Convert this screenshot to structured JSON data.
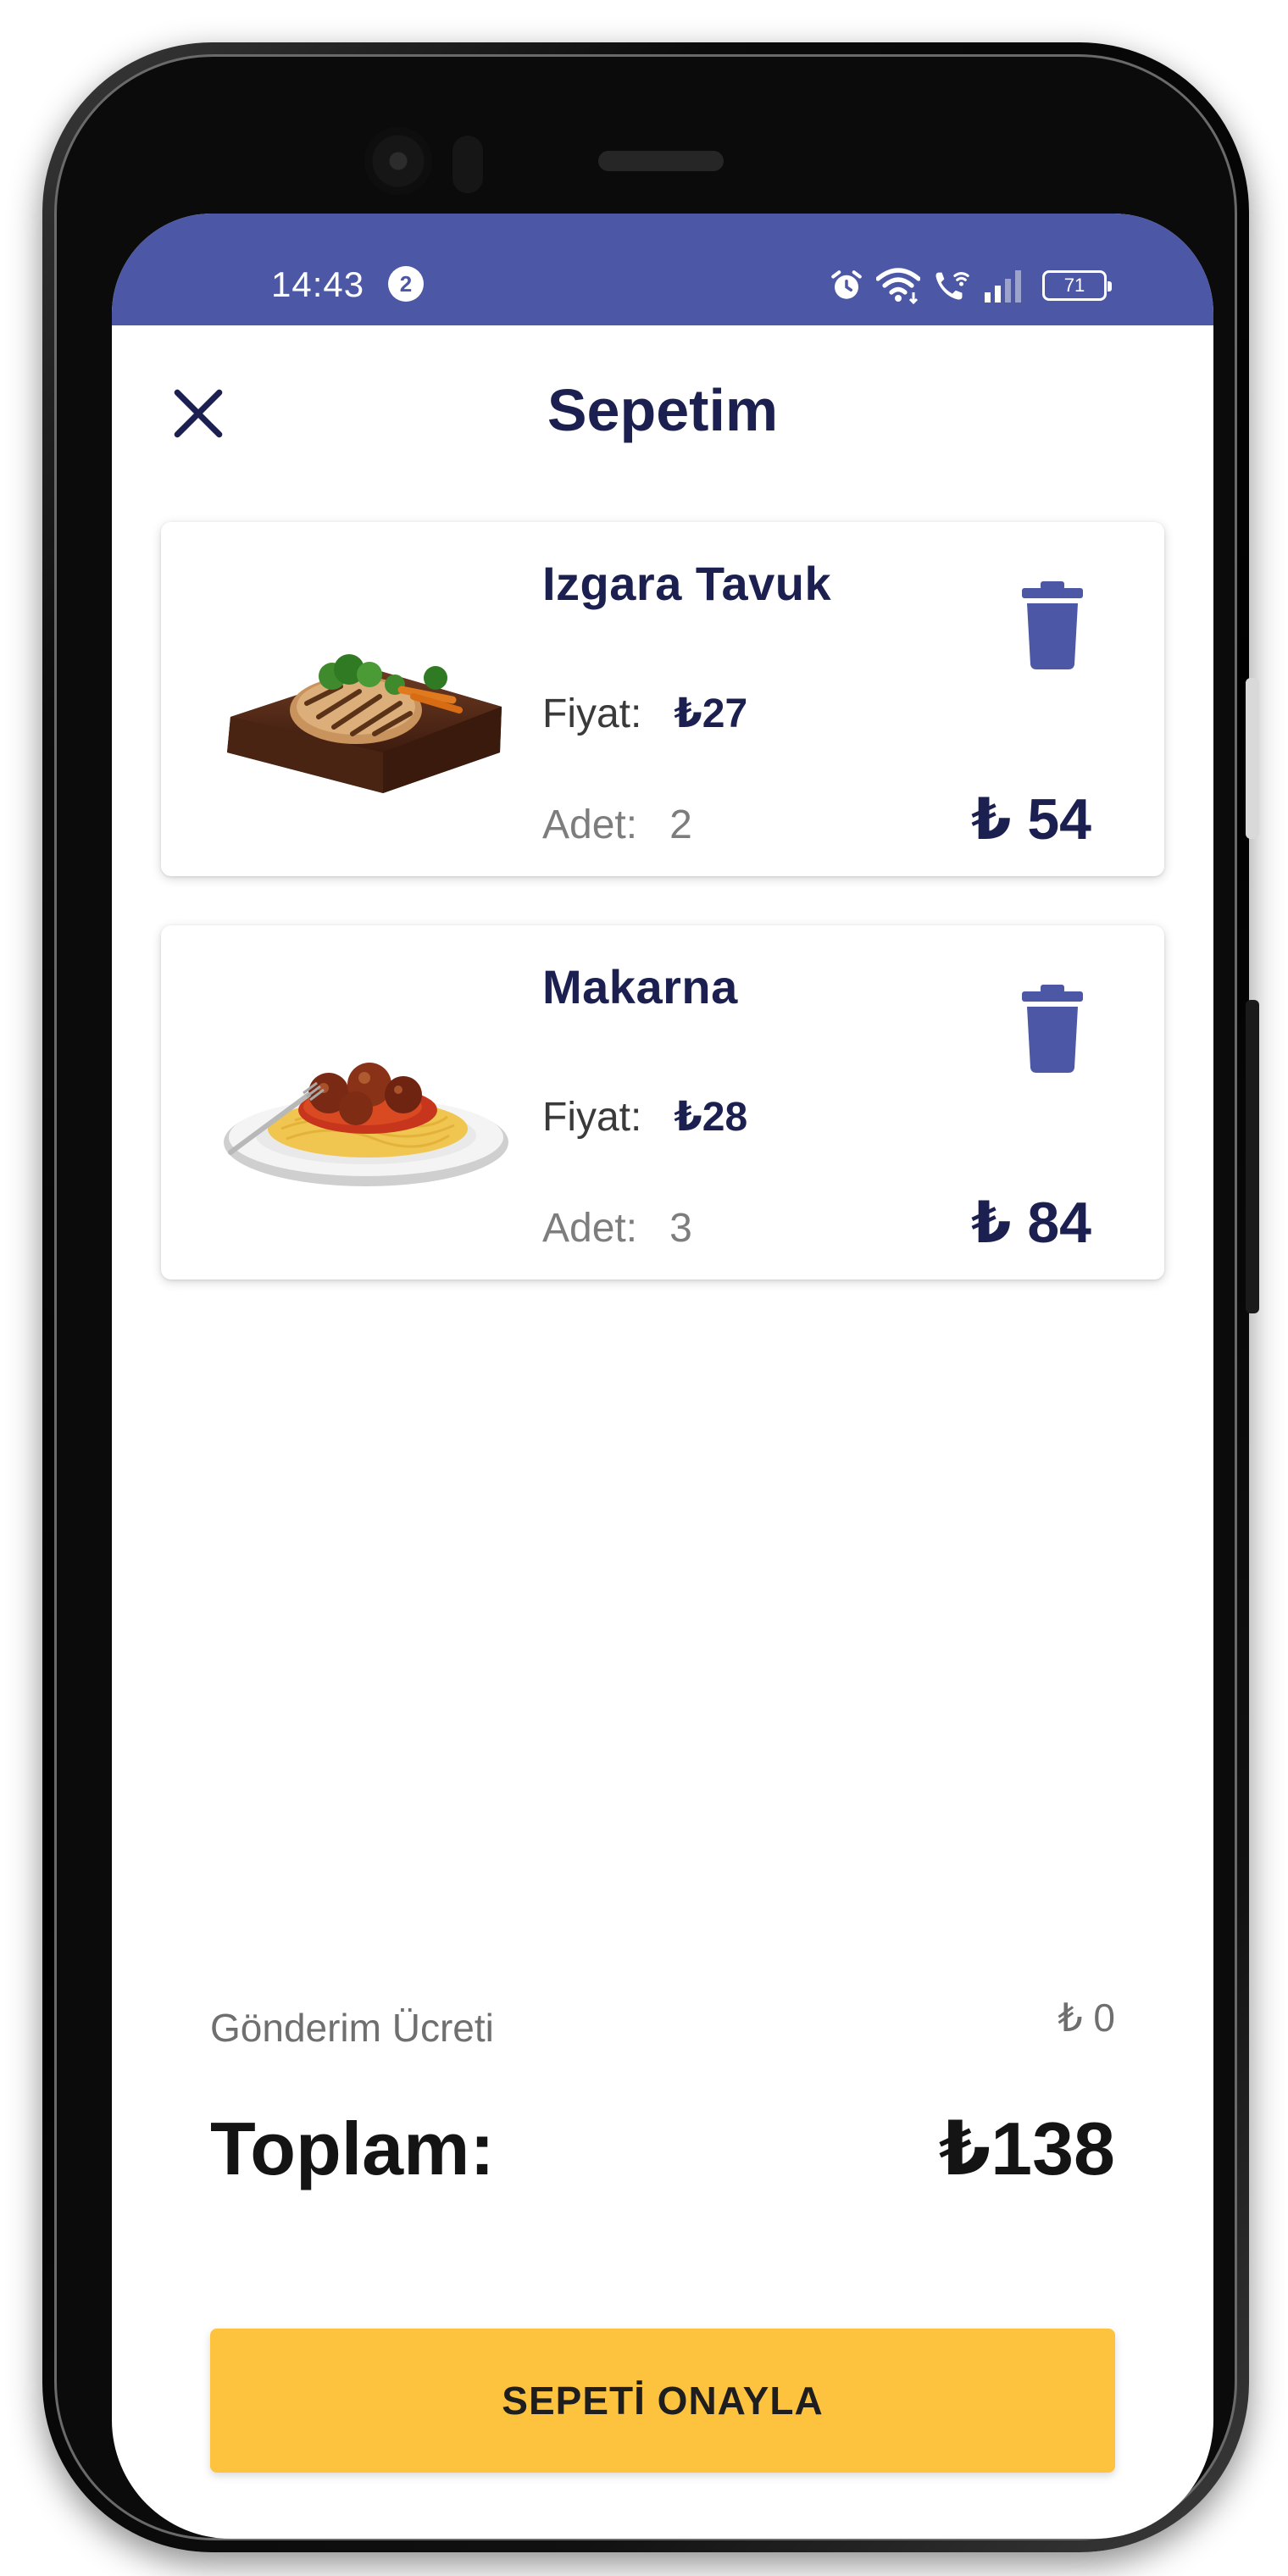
{
  "status_bar": {
    "time": "14:43",
    "notification_count": "2",
    "battery": "71",
    "icons": [
      "alarm-icon",
      "wifi-icon",
      "wifi-call-icon",
      "signal-icon",
      "battery-icon"
    ],
    "color": "#4c58a5"
  },
  "header": {
    "title": "Sepetim",
    "close_icon": "close-icon"
  },
  "cart": {
    "items": [
      {
        "name": "Izgara Tavuk",
        "price_label": "Fiyat:",
        "price": "₺27",
        "qty_label": "Adet:",
        "qty": "2",
        "line_total": "₺ 54",
        "image": "grilled-chicken-image",
        "delete_icon": "trash-icon"
      },
      {
        "name": "Makarna",
        "price_label": "Fiyat:",
        "price": "₺28",
        "qty_label": "Adet:",
        "qty": "3",
        "line_total": "₺ 84",
        "image": "spaghetti-image",
        "delete_icon": "trash-icon"
      }
    ]
  },
  "summary": {
    "shipping_label": "Gönderim Ücreti",
    "shipping_value": "₺ 0",
    "total_label": "Toplam:",
    "total_value": "₺138"
  },
  "confirm_button": {
    "label": "SEPETİ ONAYLA"
  },
  "colors": {
    "accent": "#4c58a5",
    "title": "#1c2050",
    "button": "#fdc23e"
  }
}
